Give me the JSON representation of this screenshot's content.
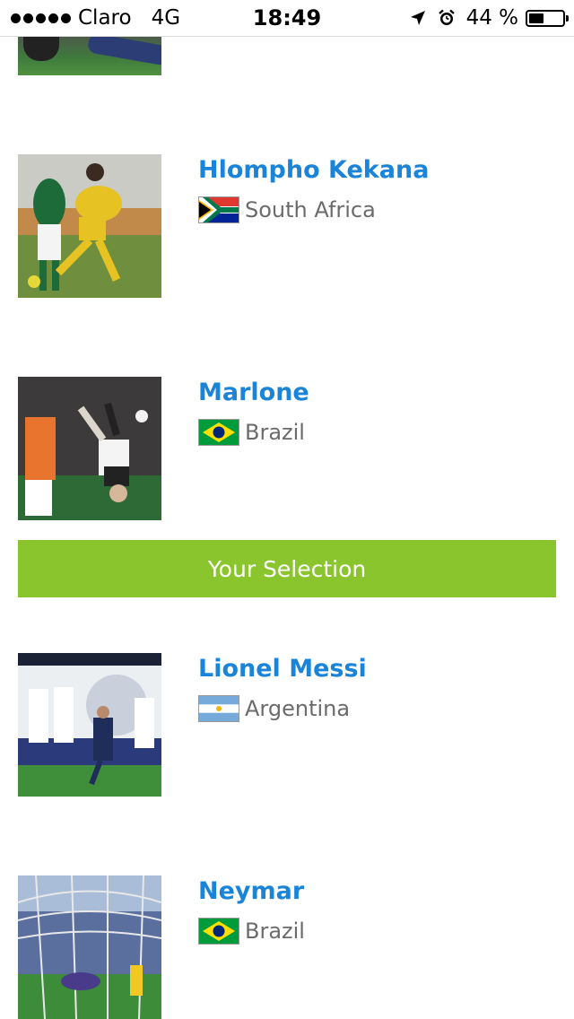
{
  "status_bar": {
    "carrier": "Claro",
    "network": "4G",
    "time": "18:49",
    "battery_text": "44 %",
    "battery_level": 0.44
  },
  "players": [
    {
      "name": "Hlompho Kekana",
      "country": "South Africa",
      "flag_icon": "south-africa-flag"
    },
    {
      "name": "Marlone",
      "country": "Brazil",
      "flag_icon": "brazil-flag"
    },
    {
      "name": "Lionel Messi",
      "country": "Argentina",
      "flag_icon": "argentina-flag"
    },
    {
      "name": "Neymar",
      "country": "Brazil",
      "flag_icon": "brazil-flag"
    }
  ],
  "selection_bar": {
    "label": "Your Selection"
  },
  "colors": {
    "name_blue": "#1a84d8",
    "country_gray": "#6b6b6b",
    "selection_green": "#8bc52d"
  }
}
